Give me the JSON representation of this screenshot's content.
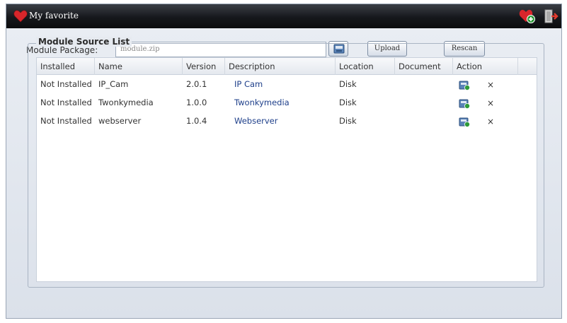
{
  "window": {
    "title": "My favorite"
  },
  "toolbar": {
    "favorite_icon": "heart-add-icon",
    "exit_icon": "exit-door-icon"
  },
  "package": {
    "label": "Module Package:",
    "value": "module.zip",
    "browse_icon": "browse-icon",
    "upload_label": "Upload",
    "rescan_label": "Rescan"
  },
  "source_list": {
    "legend": "Module Source List",
    "columns": [
      "Installed",
      "Name",
      "Version",
      "Description",
      "Location",
      "Document",
      "Action"
    ],
    "rows": [
      {
        "installed": "Not Installed",
        "name": "IP_Cam",
        "version": "2.0.1",
        "description": "IP Cam",
        "location": "Disk",
        "document": ""
      },
      {
        "installed": "Not Installed",
        "name": "Twonkymedia",
        "version": "1.0.0",
        "description": "Twonkymedia",
        "location": "Disk",
        "document": ""
      },
      {
        "installed": "Not Installed",
        "name": "webserver",
        "version": "1.0.4",
        "description": "Webserver",
        "location": "Disk",
        "document": ""
      }
    ],
    "actions": {
      "install_icon": "install-icon",
      "delete_icon": "delete-icon",
      "delete_glyph": "×"
    }
  },
  "colors": {
    "titlebar": "#16181c",
    "accent_heart": "#d8262b",
    "link_text": "#1e3f8a"
  }
}
